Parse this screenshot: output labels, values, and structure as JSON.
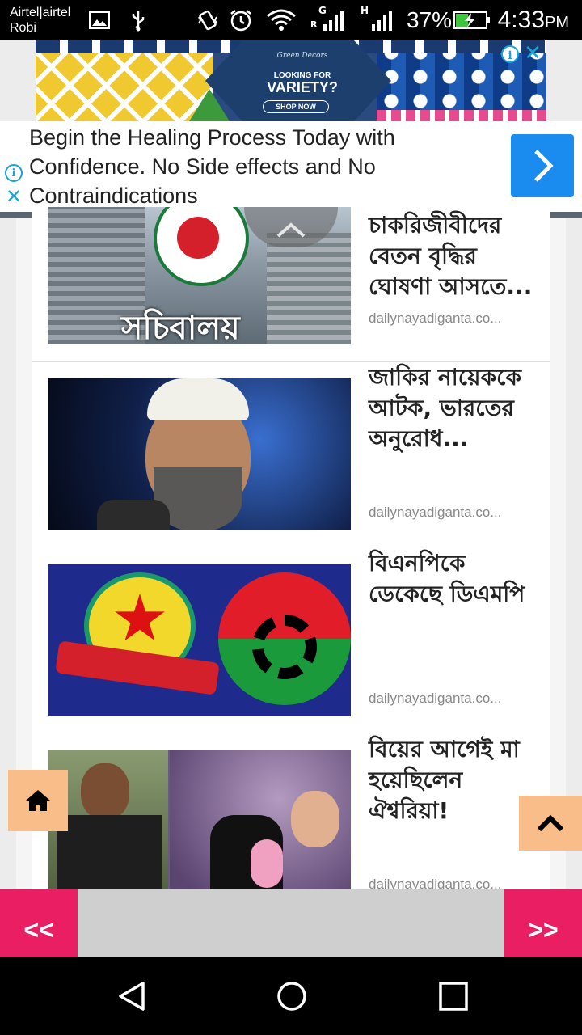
{
  "status_bar": {
    "carrier_line1": "Airtel|airtel",
    "carrier_line2": "Robi",
    "battery": "37%",
    "time": "4:33",
    "ampm": "PM",
    "net1": "G",
    "net1b": "R",
    "net2": "H"
  },
  "ad_banner": {
    "brand": "Green Decors",
    "subtitle": "LOOKING FOR",
    "headline": "VARIETY?",
    "cta": "SHOP NOW",
    "info_glyph": "i",
    "close_glyph": "✕"
  },
  "ad_text": {
    "text": "Begin the Healing Process Today with Confidence. No Side effects and No Contraindications",
    "info_glyph": "i",
    "close_glyph": "✕",
    "arrow_glyph": "›"
  },
  "articles": [
    {
      "title": "চাকরিজীবীদের বেতন বৃদ্ধির ঘোষণা আসতে...",
      "source": "dailynayadiganta.co...",
      "image_caption": "সচিবালয়"
    },
    {
      "title": "জাকির নায়েককে আটক, ভারতের অনুরোধ...",
      "source": "dailynayadiganta.co..."
    },
    {
      "title": "বিএনপিকে ডেকেছে ডিএমপি",
      "source": "dailynayadiganta.co..."
    },
    {
      "title": "বিয়ের আগেই মা হয়েছিলেন ঐশ্বরিয়া!",
      "source": "dailynayadiganta.co..."
    }
  ],
  "controls": {
    "scroll_up_glyph": "︿",
    "top_glyph": "︿"
  },
  "pager": {
    "prev_label": "<<",
    "next_label": ">>"
  },
  "colors": {
    "pager_accent": "#e91e63",
    "floating_button": "#f9bd8a",
    "ad_arrow_button": "#1a8cf0"
  },
  "icons": {
    "home": "home-icon",
    "back": "back-icon",
    "home_nav": "home-circle-icon",
    "recents": "recents-icon"
  }
}
